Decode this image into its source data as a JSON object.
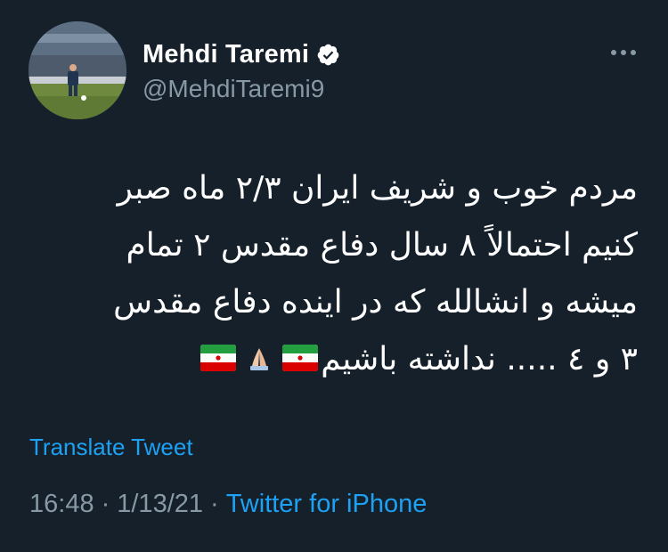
{
  "author": {
    "display_name": "Mehdi Taremi",
    "handle": "@MehdiTaremi9",
    "verified": true,
    "avatar_icon": "profile-photo-football-player"
  },
  "tweet": {
    "lines": [
      "مردم خوب و شریف ایران ۲/۳ ماه صبر",
      "کنیم احتمالاً ۸ سال دفاع مقدس ۲ تمام",
      "میشه و انشالله که در اینده دفاع مقدس",
      "۳ و ٤ ..... نداشته باشیم"
    ],
    "emojis": [
      "flag-iran-icon",
      "folded-hands-icon",
      "flag-iran-icon"
    ]
  },
  "actions": {
    "translate_label": "Translate Tweet",
    "more_icon": "more-horizontal-icon"
  },
  "meta": {
    "time": "16:48",
    "separator": "·",
    "date": "1/13/21",
    "source": "Twitter for iPhone"
  },
  "colors": {
    "background": "#15202b",
    "text": "#ffffff",
    "secondary": "#8899a6",
    "accent": "#1da1f2"
  }
}
